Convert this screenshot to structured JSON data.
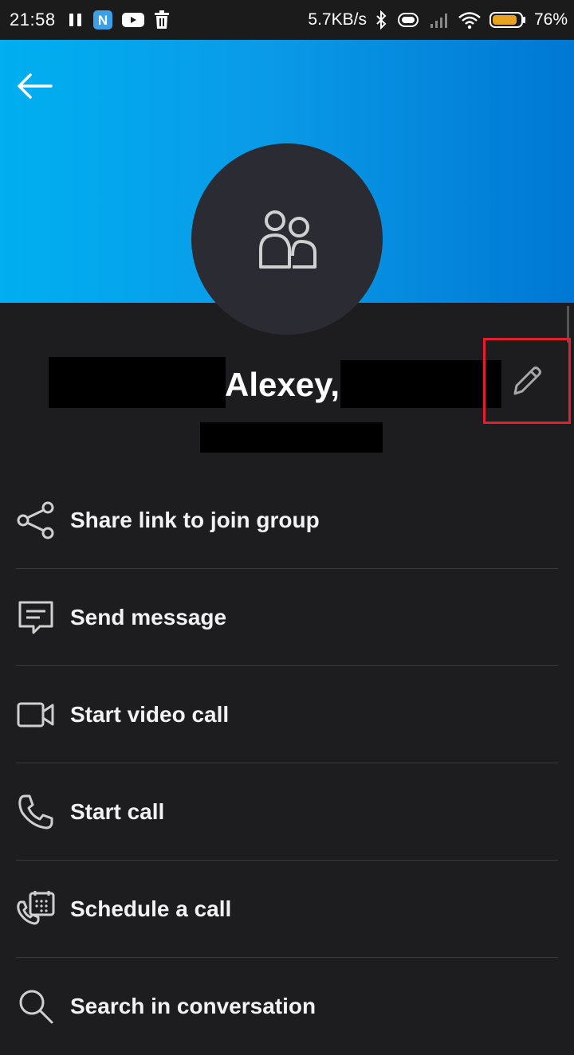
{
  "status_bar": {
    "time": "21:58",
    "net_speed": "5.7KB/s",
    "battery_percent": "76%",
    "battery_level": 0.76,
    "icons": [
      "pause-icon",
      "app-n-icon",
      "youtube-icon",
      "trash-icon",
      "bluetooth-icon",
      "vibrate-icon",
      "signal-icon",
      "wifi-icon",
      "battery-icon"
    ]
  },
  "header": {
    "gradient_start": "#00aff0",
    "gradient_end": "#0078d4",
    "back_icon": "arrow-left-icon"
  },
  "avatar": {
    "icon": "group-people-icon",
    "bg": "#2b2c33"
  },
  "profile": {
    "name_visible": "Alexey,",
    "edit_icon": "pencil-icon",
    "highlight_color": "#e0202c"
  },
  "actions": [
    {
      "label": "Share link to join group",
      "icon": "share-icon"
    },
    {
      "label": "Send message",
      "icon": "message-icon"
    },
    {
      "label": "Start video call",
      "icon": "video-camera-icon"
    },
    {
      "label": "Start call",
      "icon": "phone-icon"
    },
    {
      "label": "Schedule a call",
      "icon": "schedule-call-icon"
    },
    {
      "label": "Search in conversation",
      "icon": "search-icon"
    }
  ]
}
